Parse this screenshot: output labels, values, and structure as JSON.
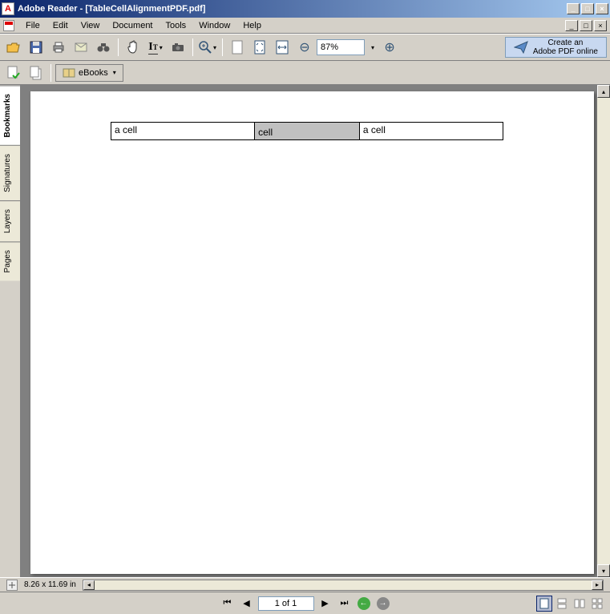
{
  "window": {
    "title": "Adobe Reader - [TableCellAlignmentPDF.pdf]"
  },
  "menu": {
    "items": [
      "File",
      "Edit",
      "View",
      "Document",
      "Tools",
      "Window",
      "Help"
    ]
  },
  "toolbar": {
    "zoom": "87%",
    "adobe_online_line1": "Create an",
    "adobe_online_line2": "Adobe PDF online",
    "ebooks": "eBooks"
  },
  "nav_tabs": [
    "Bookmarks",
    "Signatures",
    "Layers",
    "Pages"
  ],
  "document": {
    "table": {
      "rows": [
        {
          "cells": [
            {
              "text": "a cell",
              "shaded": false
            },
            {
              "text": "cell",
              "shaded": true
            },
            {
              "text": "a cell",
              "shaded": false
            }
          ]
        }
      ]
    }
  },
  "status": {
    "page_size": "8.26 x 11.69 in"
  },
  "footer": {
    "page_indicator": "1 of 1"
  }
}
